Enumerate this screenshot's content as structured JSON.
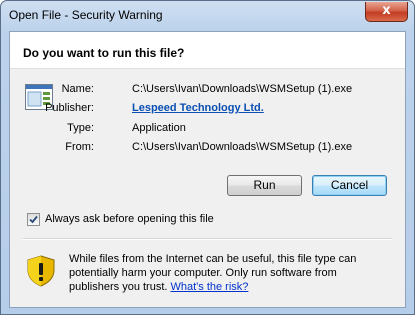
{
  "window": {
    "title": "Open File - Security Warning",
    "close_glyph": "x"
  },
  "header": {
    "question": "Do you want to run this file?"
  },
  "details": {
    "file_icon": "application-window-icon",
    "name_label": "Name:",
    "name_value": "C:\\Users\\Ivan\\Downloads\\WSMSetup (1).exe",
    "publisher_label": "Publisher:",
    "publisher_value": "Lespeed Technology Ltd.",
    "type_label": "Type:",
    "type_value": "Application",
    "from_label": "From:",
    "from_value": "C:\\Users\\Ivan\\Downloads\\WSMSetup (1).exe"
  },
  "buttons": {
    "run_label": "Run",
    "cancel_label": "Cancel"
  },
  "checkbox": {
    "label": "Always ask before opening this file",
    "checked": true
  },
  "warning": {
    "icon": "shield-warning-icon",
    "text": "While files from the Internet can be useful, this file type can potentially harm your computer. Only run software from publishers you trust.",
    "link": "What's the risk?"
  },
  "colors": {
    "link": "#0033cc",
    "close_button": "#c33c22",
    "default_button": "#a7d9f5"
  }
}
